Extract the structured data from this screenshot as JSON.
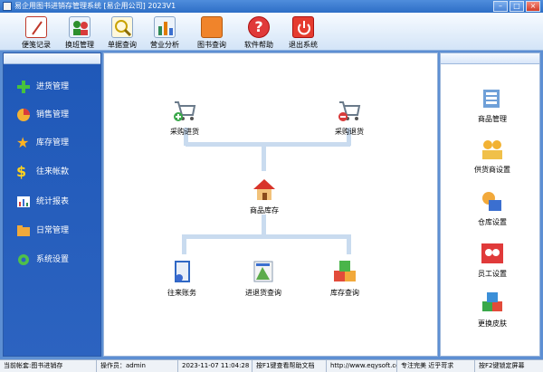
{
  "window": {
    "title": "易企用图书进销存管理系统 [易企用公司] 2023V1"
  },
  "toolbar": [
    {
      "label": "便笺记录",
      "icon": "notepad-icon"
    },
    {
      "label": "换班管理",
      "icon": "people-icon"
    },
    {
      "label": "单据查询",
      "icon": "search-icon"
    },
    {
      "label": "营业分析",
      "icon": "bar-chart-icon"
    },
    {
      "label": "图书查询",
      "icon": "book-icon"
    },
    {
      "label": "软件帮助",
      "icon": "help-icon"
    },
    {
      "label": "退出系统",
      "icon": "power-icon"
    }
  ],
  "sidebar": [
    {
      "label": "进货管理",
      "icon": "plus-icon"
    },
    {
      "label": "销售管理",
      "icon": "pie-chart-icon"
    },
    {
      "label": "库存管理",
      "icon": "star-icon"
    },
    {
      "label": "往来帐款",
      "icon": "dollar-icon"
    },
    {
      "label": "统计报表",
      "icon": "report-icon"
    },
    {
      "label": "日常管理",
      "icon": "folder-icon"
    },
    {
      "label": "系统设置",
      "icon": "gear-icon"
    }
  ],
  "flow": {
    "purchase_in": "采购进货",
    "purchase_return": "采购退货",
    "inventory": "商品库存",
    "accounts": "往来账务",
    "inout_query": "进退货查询",
    "stock_query": "库存查询"
  },
  "right_panel": [
    {
      "label": "商品管理",
      "icon": "product-icon"
    },
    {
      "label": "供货商设置",
      "icon": "supplier-icon"
    },
    {
      "label": "仓库设置",
      "icon": "warehouse-icon"
    },
    {
      "label": "员工设置",
      "icon": "staff-icon"
    },
    {
      "label": "更换皮肤",
      "icon": "skin-icon"
    }
  ],
  "status": {
    "current_module": "当前帐套:图书进销存",
    "operator": "操作员：admin",
    "datetime": "2023-11-07 11:04:28",
    "help_hint": "按F1键查看帮助文档",
    "website": "http://www.eqysoft.com/",
    "slogan": "专注完美 近乎苛求",
    "f2_hint": "按F2键锁定屏幕"
  }
}
